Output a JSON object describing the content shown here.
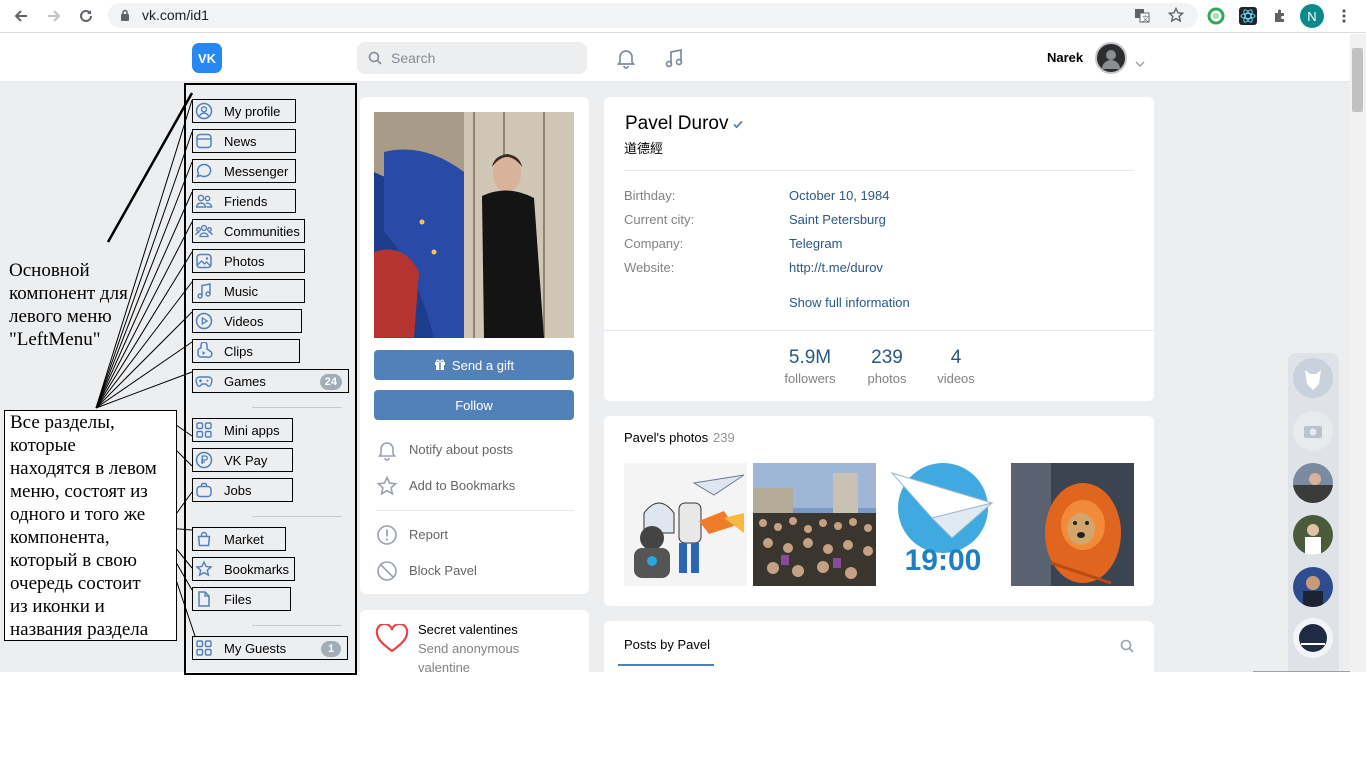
{
  "browser": {
    "url": "vk.com/id1",
    "profile_initial": "N"
  },
  "header": {
    "logo": "VK",
    "search_placeholder": "Search",
    "user_name": "Narek"
  },
  "left_menu": {
    "items": [
      {
        "label": "My profile",
        "icon": "user-circle-icon"
      },
      {
        "label": "News",
        "icon": "news-icon"
      },
      {
        "label": "Messenger",
        "icon": "chat-bubble-icon"
      },
      {
        "label": "Friends",
        "icon": "users-icon"
      },
      {
        "label": "Communities",
        "icon": "group-icon"
      },
      {
        "label": "Photos",
        "icon": "photo-icon"
      },
      {
        "label": "Music",
        "icon": "music-note-icon"
      },
      {
        "label": "Videos",
        "icon": "play-icon"
      },
      {
        "label": "Clips",
        "icon": "clips-icon"
      },
      {
        "label": "Games",
        "icon": "gamepad-icon",
        "count": "24"
      },
      {
        "label": "Mini apps",
        "icon": "apps-grid-icon"
      },
      {
        "label": "VK Pay",
        "icon": "ruble-coin-icon"
      },
      {
        "label": "Jobs",
        "icon": "briefcase-icon"
      },
      {
        "label": "Market",
        "icon": "shopping-bag-icon"
      },
      {
        "label": "Bookmarks",
        "icon": "star-icon"
      },
      {
        "label": "Files",
        "icon": "file-icon"
      },
      {
        "label": "My Guests",
        "icon": "apps-grid-icon",
        "count": "1"
      }
    ]
  },
  "annotations": {
    "main_component": [
      "Основной",
      "компонент для",
      "левого меню",
      "\"LeftMenu\""
    ],
    "sections": [
      "Все разделы,",
      "которые",
      "находятся в левом",
      "меню, состоят из",
      "одного и того же",
      "компонента,",
      "который в свою",
      "очередь состоит",
      "из иконки и",
      "названия раздела"
    ]
  },
  "profile_column": {
    "send_gift": "Send a gift",
    "follow": "Follow",
    "actions": [
      {
        "label": "Notify about posts",
        "icon": "bell-icon"
      },
      {
        "label": "Add to Bookmarks",
        "icon": "star-icon"
      },
      {
        "label": "Report",
        "icon": "exclamation-circle-icon"
      },
      {
        "label": "Block Pavel",
        "icon": "block-icon"
      }
    ],
    "valentine_title": "Secret valentines",
    "valentine_sub_1": "Send anonymous",
    "valentine_sub_2": "valentine"
  },
  "profile": {
    "name": "Pavel Durov",
    "status": "道德經",
    "info": [
      {
        "key": "Birthday:",
        "value": "October 10, 1984"
      },
      {
        "key": "Current city:",
        "value": "Saint Petersburg"
      },
      {
        "key": "Company:",
        "value": "Telegram"
      },
      {
        "key": "Website:",
        "value": "http://t.me/durov"
      }
    ],
    "show_full": "Show full information",
    "stats": [
      {
        "num": "5.9M",
        "label": "followers"
      },
      {
        "num": "239",
        "label": "photos"
      },
      {
        "num": "4",
        "label": "videos"
      }
    ]
  },
  "photos_block": {
    "title": "Pavel's photos",
    "count": "239",
    "thumb_text": "19:00"
  },
  "posts_block": {
    "tab": "Posts by Pavel"
  },
  "colors": {
    "vk_blue": "#2787f5",
    "button_blue": "#5181b8",
    "link": "#2a5885",
    "page_bg": "#edeef0"
  }
}
